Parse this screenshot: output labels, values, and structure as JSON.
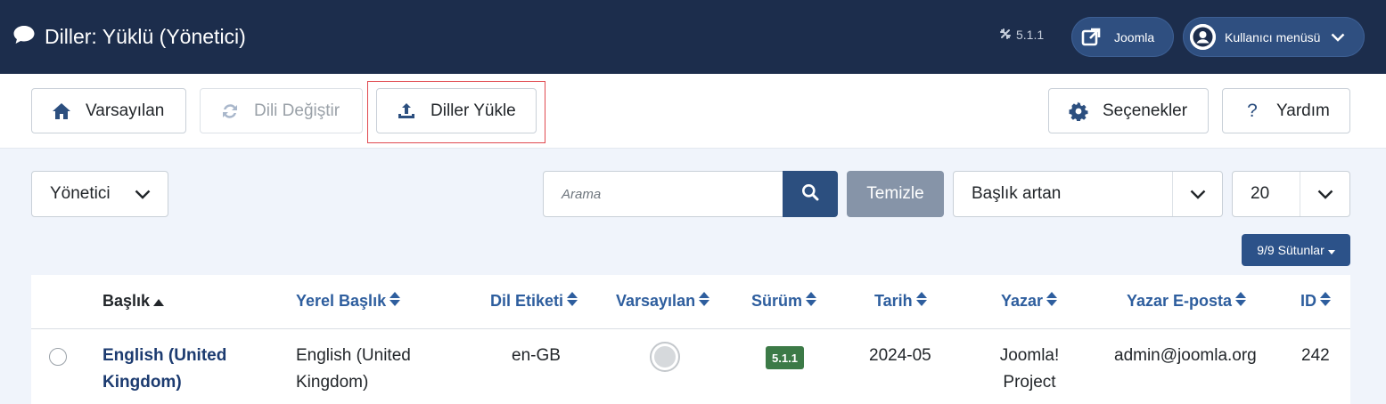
{
  "header": {
    "title": "Diller: Yüklü (Yönetici)",
    "version": "5.1.1",
    "joomla_label": "Joomla",
    "user_menu_label": "Kullanıcı menüsü"
  },
  "toolbar": {
    "default_label": "Varsayılan",
    "switch_label": "Dili Değiştir",
    "install_label": "Diller Yükle",
    "options_label": "Seçenekler",
    "help_label": "Yardım"
  },
  "filters": {
    "client_value": "Yönetici",
    "search_placeholder": "Arama",
    "clear_label": "Temizle",
    "sort_value": "Başlık artan",
    "limit_value": "20",
    "columns_label": "9/9 Sütunlar"
  },
  "table": {
    "columns": [
      "Başlık",
      "Yerel Başlık",
      "Dil Etiketi",
      "Varsayılan",
      "Sürüm",
      "Tarih",
      "Yazar",
      "Yazar E-posta",
      "ID"
    ],
    "rows": [
      {
        "title_line1": "English (United",
        "title_line2": "Kingdom)",
        "native_line1": "English (United",
        "native_line2": "Kingdom)",
        "tag": "en-GB",
        "version": "5.1.1",
        "date": "2024-05",
        "author_line1": "Joomla!",
        "author_line2": "Project",
        "email": "admin@joomla.org",
        "id": "242"
      }
    ]
  },
  "colors": {
    "header_bg": "#1c2d4c",
    "accent": "#2c4f7f",
    "highlight_border": "#e0494f",
    "version_badge": "#3c7a47"
  }
}
